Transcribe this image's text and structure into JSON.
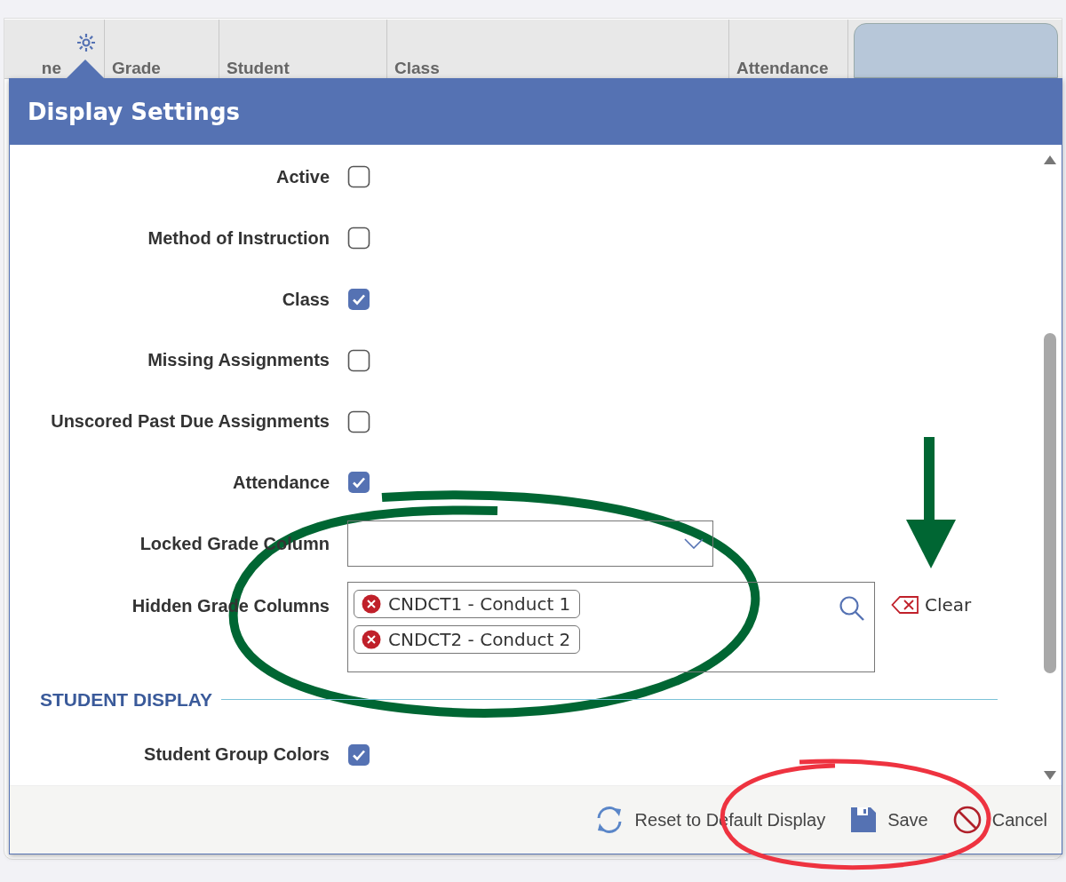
{
  "background_table": {
    "columns": [
      {
        "label": "ne"
      },
      {
        "label": "Grade"
      },
      {
        "label": "Student"
      },
      {
        "label": "Class"
      },
      {
        "label": "Attendance"
      }
    ]
  },
  "dialog": {
    "title": "Display Settings",
    "settings": [
      {
        "kind": "checkbox",
        "label": "Active",
        "checked": false
      },
      {
        "kind": "checkbox",
        "label": "Method of Instruction",
        "checked": false
      },
      {
        "kind": "checkbox",
        "label": "Class",
        "checked": true
      },
      {
        "kind": "checkbox",
        "label": "Missing Assignments",
        "checked": false
      },
      {
        "kind": "checkbox",
        "label": "Unscored Past Due Assignments",
        "checked": false
      },
      {
        "kind": "checkbox",
        "label": "Attendance",
        "checked": true
      },
      {
        "kind": "select",
        "label": "Locked Grade Column"
      },
      {
        "kind": "tags",
        "label": "Hidden Grade Columns",
        "tags": [
          "CNDCT1 - Conduct 1",
          "CNDCT2 - Conduct 2"
        ],
        "clear_label": "Clear"
      },
      {
        "kind": "section",
        "label": "STUDENT DISPLAY"
      },
      {
        "kind": "checkbox",
        "label": "Student Group Colors",
        "checked": true
      }
    ],
    "footer_buttons": [
      {
        "kind": "reset",
        "label": "Reset to Default Display"
      },
      {
        "kind": "save",
        "label": "Save"
      },
      {
        "kind": "cancel",
        "label": "Cancel"
      }
    ]
  }
}
